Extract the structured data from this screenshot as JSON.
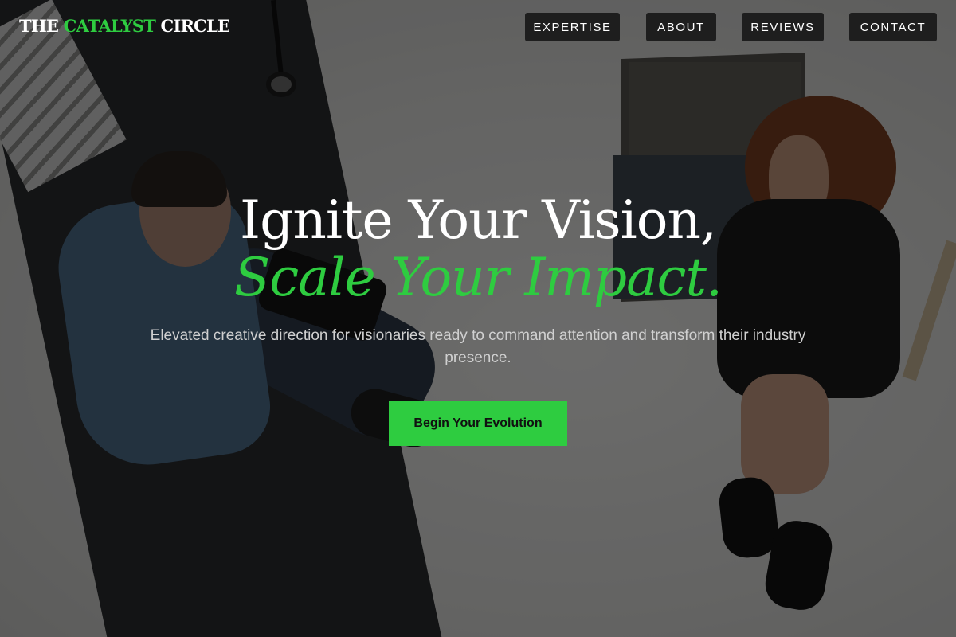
{
  "brand": {
    "logo_part1": "THE ",
    "logo_accent": "CATALYST",
    "logo_part2": " CIRCLE"
  },
  "nav": {
    "items": [
      {
        "label": "EXPERTISE"
      },
      {
        "label": "ABOUT"
      },
      {
        "label": "REVIEWS"
      },
      {
        "label": "CONTACT"
      }
    ]
  },
  "hero": {
    "headline_line1": "Ignite Your Vision,",
    "headline_line2": "Scale Your Impact.",
    "subtitle": "Elevated creative direction for visionaries ready to command attention and transform their industry presence.",
    "cta_label": "Begin Your Evolution"
  },
  "colors": {
    "accent": "#2ecc40",
    "nav_bg": "#1e1e1e",
    "text": "#ffffff"
  }
}
